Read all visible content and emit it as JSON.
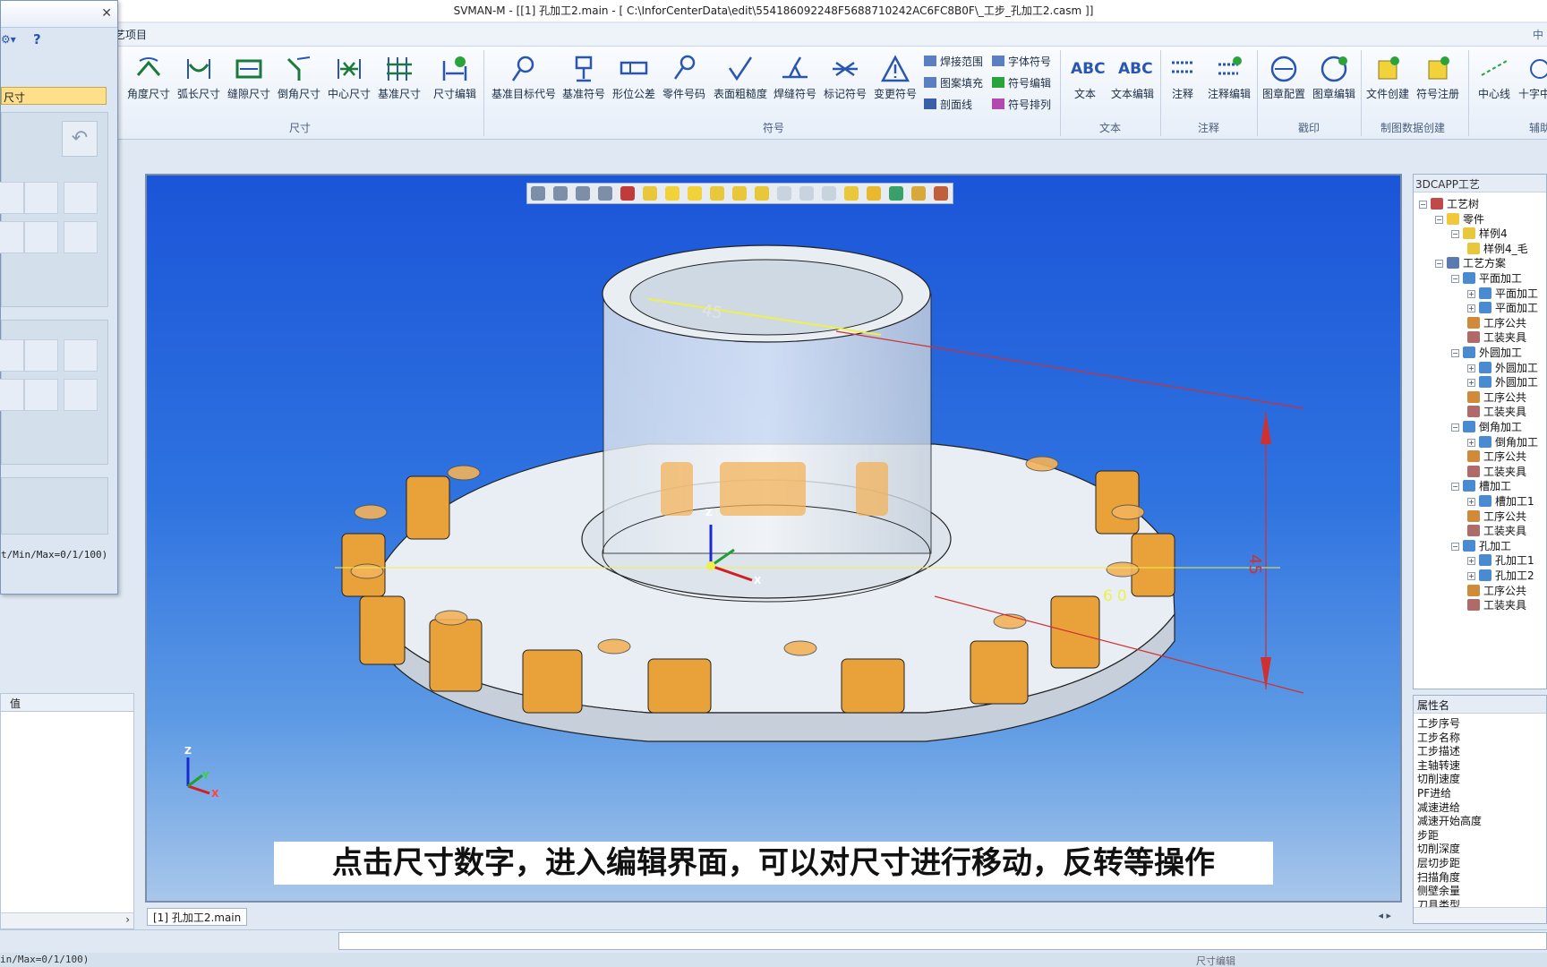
{
  "window": {
    "title": "SVMAN-M - [[1] 孔加工2.main - [ C:\\InforCenterData\\edit\\554186092248F5688710242AC6FC8B0F\\_工步_孔加工2.casm ]]",
    "restore_glyph": "中"
  },
  "menu": {
    "tab_fragment": "艺项目"
  },
  "ribbon": {
    "size_buttons": [
      "角度尺寸",
      "弧长尺寸",
      "缝隙尺寸",
      "倒角尺寸",
      "中心尺寸",
      "基准尺寸",
      "尺寸编辑"
    ],
    "size_group": "尺寸",
    "symbol_buttons": [
      "基准目标代号",
      "基准符号",
      "形位公差",
      "零件号码",
      "表面粗糙度",
      "焊缝符号",
      "标记符号",
      "变更符号"
    ],
    "symbol_small": [
      "焊接范围",
      "图案填充",
      "剖面线",
      "字体符号",
      "符号编辑",
      "符号排列"
    ],
    "symbol_group": "符号",
    "text_buttons": [
      "文本",
      "文本编辑"
    ],
    "text_group": "文本",
    "note_buttons": [
      "注释",
      "注释编辑"
    ],
    "note_group": "注释",
    "stamp_buttons": [
      "图章配置",
      "图章编辑"
    ],
    "stamp_group": "戳印",
    "data_buttons": [
      "文件创建",
      "符号注册"
    ],
    "data_group": "制图数据创建",
    "aux_buttons": [
      "中心线",
      "十字中"
    ],
    "aux_group": "辅助"
  },
  "left_dialog": {
    "field_value": "尺寸",
    "status": "t/Min/Max=0/1/100)"
  },
  "left_grid": {
    "header_value": "值"
  },
  "viewport": {
    "dimension_label": "60",
    "dimension_label_side": "45",
    "dimension_label_top": "45",
    "axis": {
      "z": "Z",
      "x": "X",
      "y": "Y"
    },
    "subtitle": "点击尺寸数字，进入编辑界面，可以对尺寸进行移动，反转等操作"
  },
  "doc_tab": "[1] 孔加工2.main",
  "right_panel": {
    "caption": "3DCAPP工艺",
    "tree": [
      {
        "label": "工艺树",
        "level": 0,
        "icon": "process-tree-icon"
      },
      {
        "label": "零件",
        "level": 1,
        "icon": "folder-icon"
      },
      {
        "label": "样例4",
        "level": 2,
        "icon": "part-cube-icon"
      },
      {
        "label": "样例4_毛",
        "level": 3,
        "icon": "part-cube-icon"
      },
      {
        "label": "工艺方案",
        "level": 1,
        "icon": "plan-icon"
      },
      {
        "label": "平面加工",
        "level": 2,
        "icon": "gear-icon"
      },
      {
        "label": "平面加工",
        "level": 3,
        "icon": "gear-icon"
      },
      {
        "label": "平面加工",
        "level": 3,
        "icon": "gear-icon"
      },
      {
        "label": "工序公共",
        "level": 3,
        "icon": "tool-icon"
      },
      {
        "label": "工装夹具",
        "level": 3,
        "icon": "fixture-icon"
      },
      {
        "label": "外圆加工",
        "level": 2,
        "icon": "gear-icon"
      },
      {
        "label": "外圆加工",
        "level": 3,
        "icon": "gear-icon"
      },
      {
        "label": "外圆加工",
        "level": 3,
        "icon": "gear-icon"
      },
      {
        "label": "工序公共",
        "level": 3,
        "icon": "tool-icon"
      },
      {
        "label": "工装夹具",
        "level": 3,
        "icon": "fixture-icon"
      },
      {
        "label": "倒角加工",
        "level": 2,
        "icon": "gear-icon"
      },
      {
        "label": "倒角加工",
        "level": 3,
        "icon": "gear-icon"
      },
      {
        "label": "工序公共",
        "level": 3,
        "icon": "tool-icon"
      },
      {
        "label": "工装夹具",
        "level": 3,
        "icon": "fixture-icon"
      },
      {
        "label": "槽加工",
        "level": 2,
        "icon": "gear-icon"
      },
      {
        "label": "槽加工1",
        "level": 3,
        "icon": "gear-icon"
      },
      {
        "label": "工序公共",
        "level": 3,
        "icon": "tool-icon"
      },
      {
        "label": "工装夹具",
        "level": 3,
        "icon": "fixture-icon"
      },
      {
        "label": "孔加工",
        "level": 2,
        "icon": "gear-icon"
      },
      {
        "label": "孔加工1",
        "level": 3,
        "icon": "gear-icon"
      },
      {
        "label": "孔加工2",
        "level": 3,
        "icon": "gear-icon"
      },
      {
        "label": "工序公共",
        "level": 3,
        "icon": "tool-icon"
      },
      {
        "label": "工装夹具",
        "level": 3,
        "icon": "fixture-icon"
      }
    ]
  },
  "properties": {
    "header": "属性名",
    "items": [
      "工步序号",
      "工步名称",
      "工步描述",
      "主轴转速",
      "切削速度",
      "PF进给",
      "减速进给",
      "减速开始高度",
      "步距",
      "切削深度",
      "层切步距",
      "扫描角度",
      "侧壁余量",
      "刀具类型"
    ]
  },
  "status": {
    "left": "in/Max=0/1/100)",
    "right": "尺寸编辑"
  },
  "colors": {
    "accent": "#2f73e0",
    "highlight": "#ffe08a",
    "orange": "#f0a03a"
  }
}
